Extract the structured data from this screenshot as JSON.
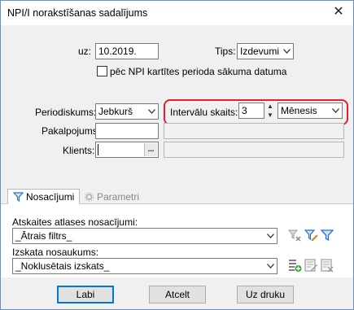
{
  "window": {
    "title": "NPI/I norakstīšanas sadalījums"
  },
  "form": {
    "uz_label": "uz:",
    "uz_value": "10.2019.",
    "tips_label": "Tips:",
    "tips_value": "Izdevumi",
    "checkbox_label": "pēc NPI kartītes perioda sākuma datuma",
    "periodiskums_label": "Periodiskums:",
    "periodiskums_value": "Jebkurš",
    "intervalu_label": "Intervālu skaits:",
    "intervalu_value": "3",
    "period_unit_value": "Mēnesis",
    "pakalpojums_label": "Pakalpojums:",
    "pakalpojums_value": "",
    "klients_label": "Klients:",
    "klients_value": "",
    "klients_button": "..."
  },
  "tabs": [
    {
      "label": "Nosacījumi",
      "icon": "filter-icon"
    },
    {
      "label": "Parametri",
      "icon": "gear-icon"
    }
  ],
  "conditions": {
    "filter_label": "Atskaites atlases nosacījumi:",
    "filter_value": "_Ātrais filtrs_",
    "layout_label": "Izskata nosaukums:",
    "layout_value": "_Noklusētais izskats_"
  },
  "buttons": {
    "ok": "Labi",
    "cancel": "Atcelt",
    "print": "Uz druku"
  }
}
